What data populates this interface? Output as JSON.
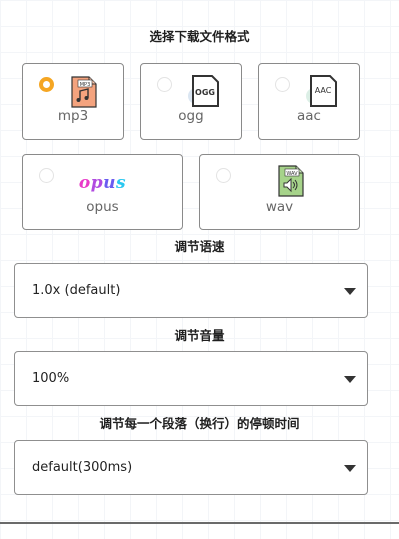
{
  "format_section": {
    "title": "选择下载文件格式",
    "selected": "mp3",
    "options": [
      {
        "id": "mp3",
        "label": "mp3",
        "icon": "mp3-file-icon",
        "badge": "MP3"
      },
      {
        "id": "ogg",
        "label": "ogg",
        "icon": "ogg-file-icon",
        "badge": "OGG"
      },
      {
        "id": "aac",
        "label": "aac",
        "icon": "aac-file-icon",
        "badge": "AAC"
      },
      {
        "id": "opus",
        "label": "opus",
        "icon": "opus-logo-icon",
        "logo_text": "opus"
      },
      {
        "id": "wav",
        "label": "wav",
        "icon": "wav-file-icon",
        "badge": "WAV"
      }
    ]
  },
  "speed": {
    "title": "调节语速",
    "value": "1.0x (default)"
  },
  "volume": {
    "title": "调节音量",
    "value": "100%"
  },
  "pause": {
    "title": "调节每一个段落（换行）的停顿时间",
    "value": "default(300ms)"
  },
  "colors": {
    "radio_checked": "#f5a623",
    "mp3_icon": "#f4a37e",
    "wav_icon": "#a6d38a",
    "opus_gradient": [
      "#e83ac8",
      "#6a5cf0",
      "#29c7f0"
    ]
  }
}
